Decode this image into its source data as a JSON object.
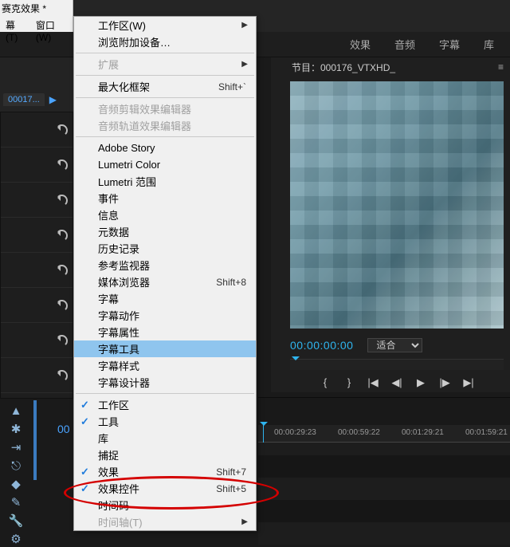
{
  "menubar": {
    "title": "赛克效果 *",
    "menu_t": "幕(T)",
    "menu_w": "窗口(W)"
  },
  "workspace_tabs": {
    "t1": "效果",
    "t2": "音频",
    "t3": "字幕",
    "t4": "库"
  },
  "left": {
    "file_tab": "00017...",
    "seq_tab": "00"
  },
  "dropdown": {
    "workspace": "工作区(W)",
    "browse_addons": "浏览附加设备…",
    "extensions": "扩展",
    "maximize_frame": "最大化框架",
    "maximize_accel": "Shift+`",
    "audio_clip_fx": "音频剪辑效果编辑器",
    "audio_track_fx": "音频轨道效果编辑器",
    "adobe_story": "Adobe Story",
    "lumetri_color": "Lumetri Color",
    "lumetri_scopes": "Lumetri 范围",
    "events": "事件",
    "info": "信息",
    "metadata": "元数据",
    "history": "历史记录",
    "ref_monitor": "参考监视器",
    "media_browser": "媒体浏览器",
    "media_browser_accel": "Shift+8",
    "captions": "字幕",
    "caption_actions": "字幕动作",
    "titler_props": "字幕属性",
    "titler_tools": "字幕工具",
    "titler_styles": "字幕样式",
    "titler_designer": "字幕设计器",
    "workarea": "工作区",
    "tools": "工具",
    "library": "库",
    "capture": "捕捉",
    "effects": "效果",
    "effects_accel": "Shift+7",
    "effect_controls": "效果控件",
    "effect_controls_accel": "Shift+5",
    "timecode": "时间码",
    "timeline_cut": "时间轴(T)"
  },
  "program_monitor": {
    "tab_label": "节目：000176_VTXHD_",
    "timecode": "00:00:00:00",
    "fit": "适合"
  },
  "timeline_ruler": {
    "t1": "00:00:29:23",
    "t2": "00:00:59:22",
    "t3": "00:01:29:21",
    "t4": "00:01:59:21"
  }
}
